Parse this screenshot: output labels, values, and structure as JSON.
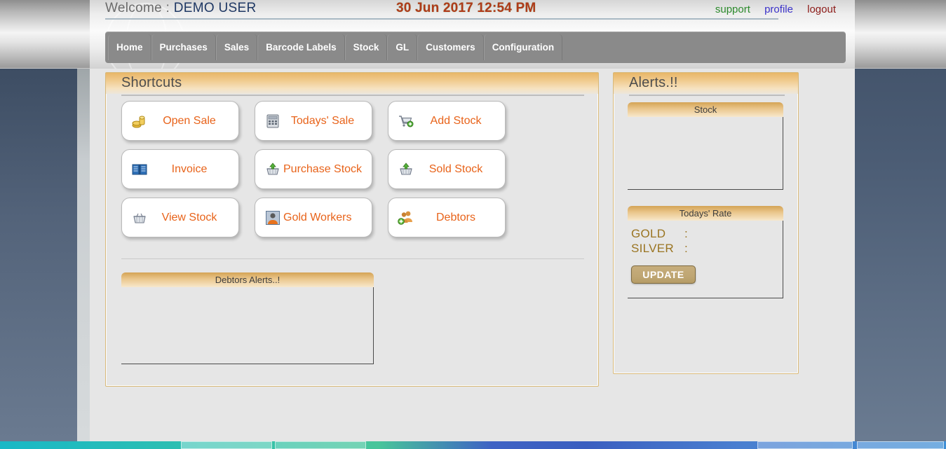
{
  "header": {
    "welcome_label": "Welcome :",
    "user_name": "DEMO USER",
    "datetime": "30 Jun 2017 12:54 PM",
    "links": [
      {
        "label": "support",
        "name": "support-link"
      },
      {
        "label": "profile",
        "name": "profile-link"
      },
      {
        "label": "logout",
        "name": "logout-link"
      }
    ]
  },
  "nav": {
    "items": [
      {
        "label": "Home"
      },
      {
        "label": "Purchases"
      },
      {
        "label": "Sales"
      },
      {
        "label": "Barcode Labels"
      },
      {
        "label": "Stock"
      },
      {
        "label": "GL"
      },
      {
        "label": "Customers"
      },
      {
        "label": "Configuration"
      }
    ]
  },
  "shortcuts": {
    "title": "Shortcuts",
    "rows": [
      [
        {
          "label": "Open Sale",
          "icon": "gold-coins-icon"
        },
        {
          "label": "Todays' Sale",
          "icon": "calculator-icon"
        },
        {
          "label": "Add Stock",
          "icon": "cart-add-icon"
        }
      ],
      [
        {
          "label": "Invoice",
          "icon": "book-icon"
        },
        {
          "label": "Purchase Stock",
          "icon": "basket-in-icon"
        },
        {
          "label": "Sold Stock",
          "icon": "basket-out-icon"
        }
      ],
      [
        {
          "label": "View Stock",
          "icon": "basket-icon"
        },
        {
          "label": "Gold Workers",
          "icon": "worker-avatar-icon"
        },
        {
          "label": "Debtors",
          "icon": "people-add-icon"
        }
      ]
    ],
    "debtors_alerts": {
      "title": "Debtors Alerts..!",
      "content": ""
    }
  },
  "alerts": {
    "title": "Alerts.!!",
    "stock": {
      "title": "Stock",
      "content": ""
    },
    "todays_rate": {
      "title": "Todays' Rate",
      "gold_label": "GOLD",
      "gold_colon": ":",
      "gold_value": "",
      "silver_label": "SILVER",
      "silver_colon": ":",
      "silver_value": "",
      "update_label": "UPDATE"
    }
  },
  "colors": {
    "accent_orange": "#e8631a",
    "panel_border": "#d8b878",
    "header_gold": "#e8b668",
    "nav_gray": "#8a8a8a",
    "rate_text": "#9a7421",
    "datetime_red": "#b03a1a"
  }
}
